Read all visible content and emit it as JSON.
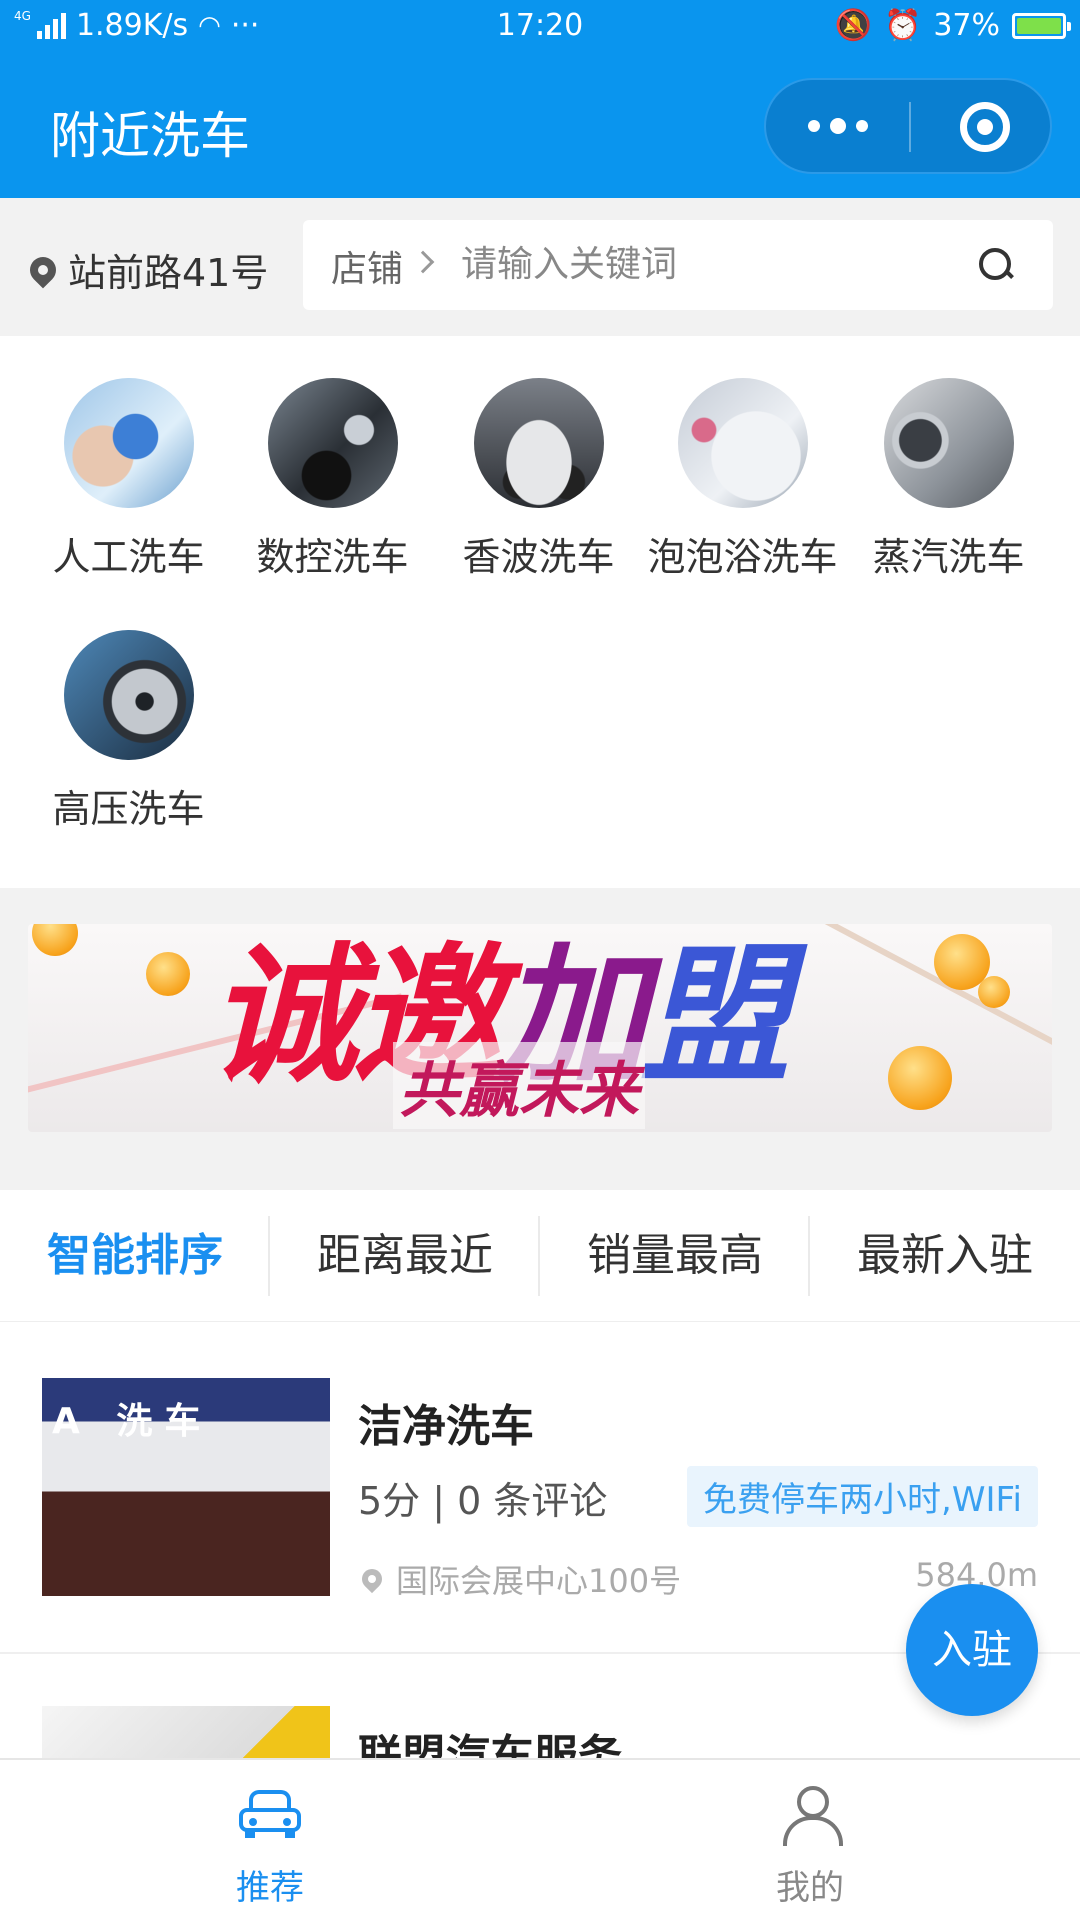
{
  "status_bar": {
    "network": "4G",
    "speed": "1.89K/s",
    "more": "···",
    "time": "17:20",
    "battery": "37%"
  },
  "header": {
    "title": "附近洗车",
    "more_icon": "more-dots-icon",
    "close_icon": "target-icon"
  },
  "location": {
    "address": "站前路41号"
  },
  "search": {
    "scope": "店铺",
    "placeholder": "请输入关键词"
  },
  "categories": [
    {
      "label": "人工洗车"
    },
    {
      "label": "数控洗车"
    },
    {
      "label": "香波洗车"
    },
    {
      "label": "泡泡浴洗车"
    },
    {
      "label": "蒸汽洗车"
    },
    {
      "label": "高压洗车"
    }
  ],
  "banner": {
    "headline": "诚邀加盟",
    "subline": "共赢未来"
  },
  "sort_tabs": [
    "智能排序",
    "距离最近",
    "销量最高",
    "最新入驻"
  ],
  "shops": [
    {
      "name": "洁净洗车",
      "photo_sign": "A 洗车",
      "rating": "5分 | 0 条评论",
      "tag": "免费停车两小时,WIFi",
      "address": "国际会展中心100号",
      "distance": "584.0m"
    },
    {
      "name": "联盟汽车服务"
    }
  ],
  "fab": {
    "label": "入驻"
  },
  "tab_bar": [
    {
      "label": "推荐",
      "icon": "car-icon",
      "active": true
    },
    {
      "label": "我的",
      "icon": "person-icon",
      "active": false
    }
  ],
  "colors": {
    "primary": "#0a95ee",
    "accent": "#1a8ff0",
    "tag_bg": "#e9f4fd"
  }
}
